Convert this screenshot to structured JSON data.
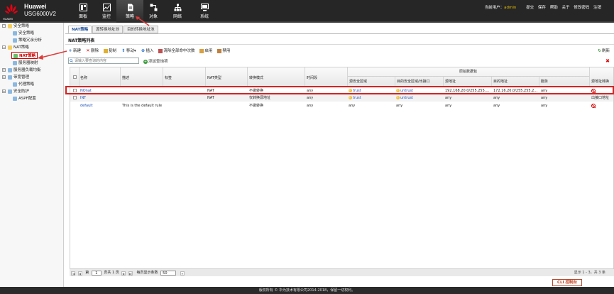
{
  "header": {
    "logo_text": "HUAWEI",
    "brand_name": "Huawei",
    "model": "USG6000V2",
    "nav": [
      {
        "label": "面板",
        "icon": "dashboard-icon"
      },
      {
        "label": "监控",
        "icon": "monitor-icon"
      },
      {
        "label": "策略",
        "icon": "policy-icon"
      },
      {
        "label": "对象",
        "icon": "object-icon"
      },
      {
        "label": "网络",
        "icon": "network-icon"
      },
      {
        "label": "系统",
        "icon": "system-icon"
      }
    ],
    "user_label": "当前用户：",
    "user_name": "admin",
    "links": [
      "提交",
      "保存",
      "帮助",
      "关于",
      "修改密码",
      "注销"
    ]
  },
  "sidebar": {
    "items": [
      {
        "label": "安全策略",
        "level": 0
      },
      {
        "label": "安全策略",
        "level": 1
      },
      {
        "label": "策略冗余分析",
        "level": 1
      },
      {
        "label": "NAT策略",
        "level": 0
      },
      {
        "label": "NAT策略",
        "level": 1,
        "selected": true
      },
      {
        "label": "服务器映射",
        "level": 1
      },
      {
        "label": "服务器负载均衡",
        "level": 0
      },
      {
        "label": "带宽管理",
        "level": 0
      },
      {
        "label": "代理策略",
        "level": 1
      },
      {
        "label": "安全防护",
        "level": 0
      },
      {
        "label": "ASPF配置",
        "level": 1
      }
    ]
  },
  "tabs": [
    "NAT策略",
    "源转换地址池",
    "目的转换地址池"
  ],
  "panel_title": "NAT策略列表",
  "toolbar": {
    "new": "新建",
    "delete": "删除",
    "copy": "复制",
    "move": "移动▾",
    "insert": "插入",
    "clear_hits": "清除全部命中次数",
    "enable": "启用",
    "disable": "禁用",
    "refresh": "刷新"
  },
  "search": {
    "placeholder": "请输入要查询的内容",
    "add_condition": "添加查询项"
  },
  "table": {
    "headers": {
      "name": "名称",
      "desc": "描述",
      "tag": "标签",
      "nat_type": "NAT类型",
      "mode": "转换模式",
      "time": "时间段",
      "group": "原始数据包",
      "src_zone": "源安全区域",
      "dst_zone": "目的安全区域/出接口",
      "src_addr": "源地址",
      "dst_addr": "目的地址",
      "service": "服务",
      "src_trans": "源地址转换"
    },
    "rows": [
      {
        "name": "NOnat",
        "desc": "",
        "tag": "",
        "nat_type": "NAT",
        "mode": "不做转换",
        "time": "any",
        "src_zone": "trust",
        "dst_zone": "untrust",
        "src_addr": "192.168.20.0/255.255....",
        "dst_addr": "172.16.20.0/255.255.2...",
        "service": "any",
        "src_trans": "ban"
      },
      {
        "name": "INT",
        "desc": "",
        "tag": "",
        "nat_type": "NAT",
        "mode": "仅转换源地址",
        "time": "any",
        "src_zone": "trust",
        "dst_zone": "untrust",
        "src_addr": "any",
        "dst_addr": "any",
        "service": "any",
        "src_trans": "出接口地址"
      },
      {
        "name": "default",
        "desc": "This is the default rule",
        "tag": "",
        "nat_type": "",
        "mode": "不做转换",
        "time": "any",
        "src_zone": "any",
        "dst_zone": "any",
        "src_addr": "any",
        "dst_addr": "any",
        "service": "any",
        "src_trans": "ban"
      }
    ]
  },
  "pager": {
    "page_prefix": "第",
    "page": "1",
    "page_suffix": "页共 1 页",
    "per_page_label": "每页显示条数",
    "per_page": "50",
    "info": "显示 1 - 3，共 3 条"
  },
  "cli_button": "CLI 控制台",
  "footer": "版权所有 © 华为技术有限公司2014-2018，保留一切权利。",
  "colors": {
    "header_bg": "#262626",
    "highlight": "#d42323",
    "link": "#1a4fb5",
    "selected": "#cc0000"
  }
}
